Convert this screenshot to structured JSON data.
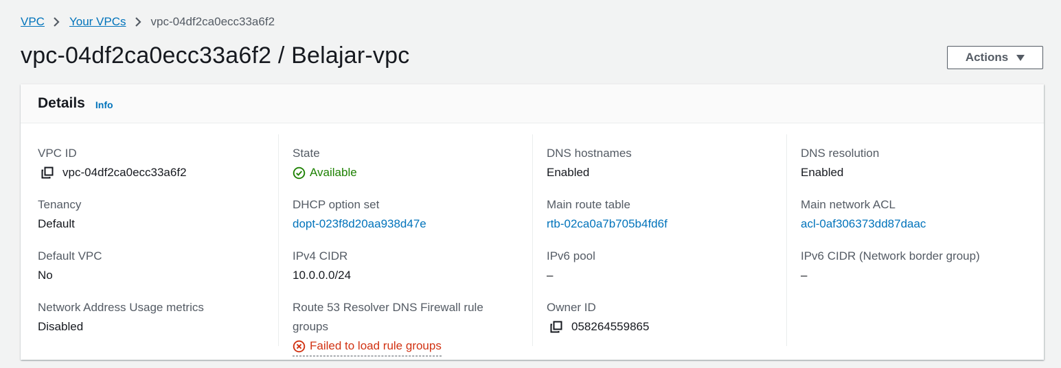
{
  "breadcrumb": {
    "items": [
      "VPC",
      "Your VPCs"
    ],
    "current": "vpc-04df2ca0ecc33a6f2"
  },
  "page": {
    "title": "vpc-04df2ca0ecc33a6f2 / Belajar-vpc",
    "actions_label": "Actions"
  },
  "details": {
    "title": "Details",
    "info_label": "Info",
    "fields": {
      "vpc_id": {
        "label": "VPC ID",
        "value": "vpc-04df2ca0ecc33a6f2"
      },
      "tenancy": {
        "label": "Tenancy",
        "value": "Default"
      },
      "default_vpc": {
        "label": "Default VPC",
        "value": "No"
      },
      "nau_metrics": {
        "label": "Network Address Usage metrics",
        "value": "Disabled"
      },
      "state": {
        "label": "State",
        "value": "Available"
      },
      "dhcp": {
        "label": "DHCP option set",
        "value": "dopt-023f8d20aa938d47e"
      },
      "ipv4_cidr": {
        "label": "IPv4 CIDR",
        "value": "10.0.0.0/24"
      },
      "route53": {
        "label_line1": "Route 53 Resolver DNS Firewall rule",
        "label_line2": "groups",
        "value": "Failed to load rule groups"
      },
      "dns_hostnames": {
        "label": "DNS hostnames",
        "value": "Enabled"
      },
      "main_route_table": {
        "label": "Main route table",
        "value": "rtb-02ca0a7b705b4fd6f"
      },
      "ipv6_pool": {
        "label": "IPv6 pool",
        "value": "–"
      },
      "owner_id": {
        "label": "Owner ID",
        "value": "058264559865"
      },
      "dns_resolution": {
        "label": "DNS resolution",
        "value": "Enabled"
      },
      "main_network_acl": {
        "label": "Main network ACL",
        "value": "acl-0af306373dd87daac"
      },
      "ipv6_cidr": {
        "label": "IPv6 CIDR (Network border group)",
        "value": "–"
      }
    }
  },
  "colors": {
    "link": "#0073bb",
    "success": "#1d8102",
    "error": "#d13212",
    "label": "#545b64",
    "text": "#16191f",
    "background": "#f2f3f3"
  },
  "icons": [
    "chevron-right-icon",
    "copy-icon",
    "check-circle-icon",
    "error-circle-icon",
    "caret-down-icon"
  ]
}
